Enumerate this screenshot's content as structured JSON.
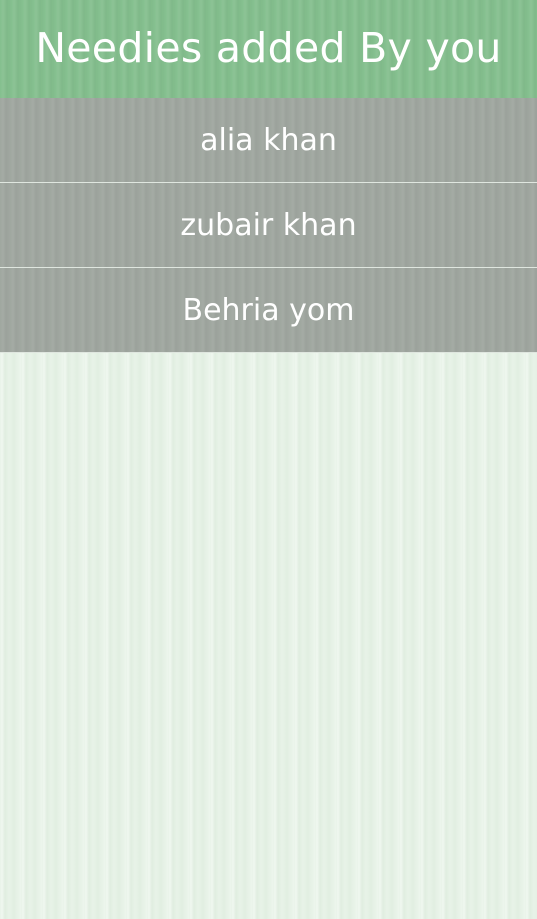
{
  "header": {
    "title": "Needies added By you"
  },
  "needies": [
    {
      "name": "alia khan"
    },
    {
      "name": "zubair khan"
    },
    {
      "name": "Behria yom"
    }
  ],
  "colors": {
    "header_bg": "#84bf8e",
    "item_bg": "#a0a7a0",
    "screen_bg": "#e8f3e8",
    "text": "#ffffff"
  }
}
